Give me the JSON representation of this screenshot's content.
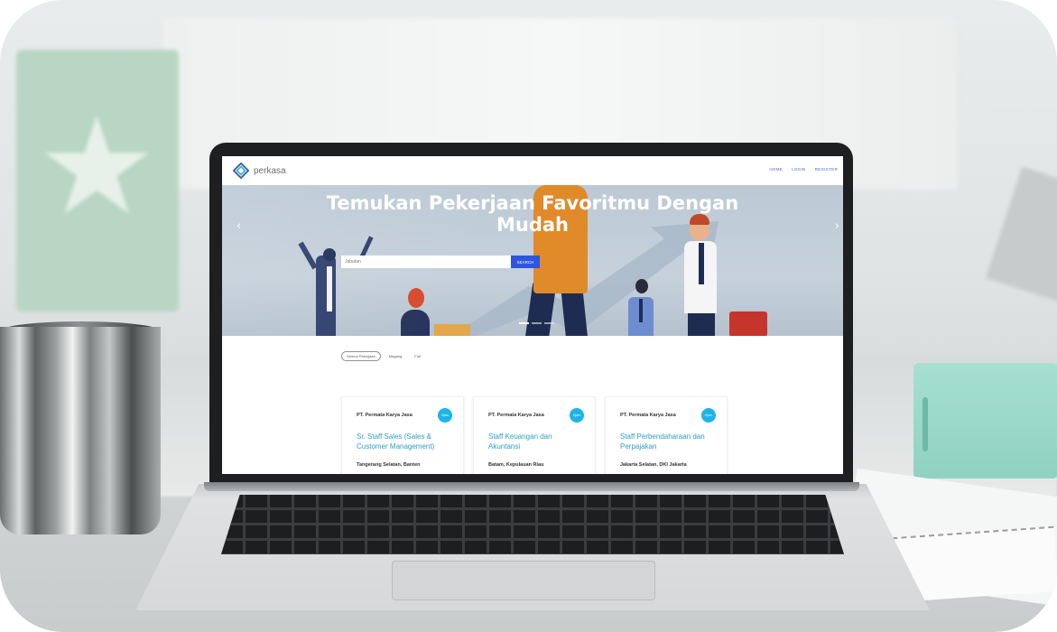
{
  "brand": {
    "name": "perkasa",
    "logo_icon": "diamond-logo-icon"
  },
  "nav": {
    "links": [
      "HOME",
      "LOGIN",
      "REGISTER"
    ],
    "link_color": "#4a67c8"
  },
  "hero": {
    "title_line1": "Temukan Pekerjaan Favoritmu Dengan",
    "title_line2": "Mudah",
    "search_placeholder": "Jabatan",
    "search_button": "SEARCH",
    "prev_glyph": "‹",
    "next_glyph": "›",
    "slides": 3,
    "active_slide": 1
  },
  "tabs": {
    "items": [
      "Semua Pekerjaan",
      "Magang",
      "Full"
    ],
    "active_index": 0
  },
  "cards": [
    {
      "company": "PT. Permata Karya Jasa",
      "badge": "Open",
      "title": "Sr. Staff Sales (Sales & Customer Management)",
      "location": "Tangerang Selatan, Banten"
    },
    {
      "company": "PT. Permata Karya Jasa",
      "badge": "Open",
      "title": "Staff Keuangan dan Akuntansi",
      "location": "Batam, Kepulauan Riau"
    },
    {
      "company": "PT. Permata Karya Jasa",
      "badge": "Open",
      "title": "Staff Perbendaharaan dan Perpajakan",
      "location": "Jakarta Selatan, DKI Jakarta"
    }
  ],
  "colors": {
    "accent": "#2d55e0",
    "badge": "#1db4e8",
    "card_title": "#2d9ec7",
    "hero_bg": "#bcc9d5"
  }
}
